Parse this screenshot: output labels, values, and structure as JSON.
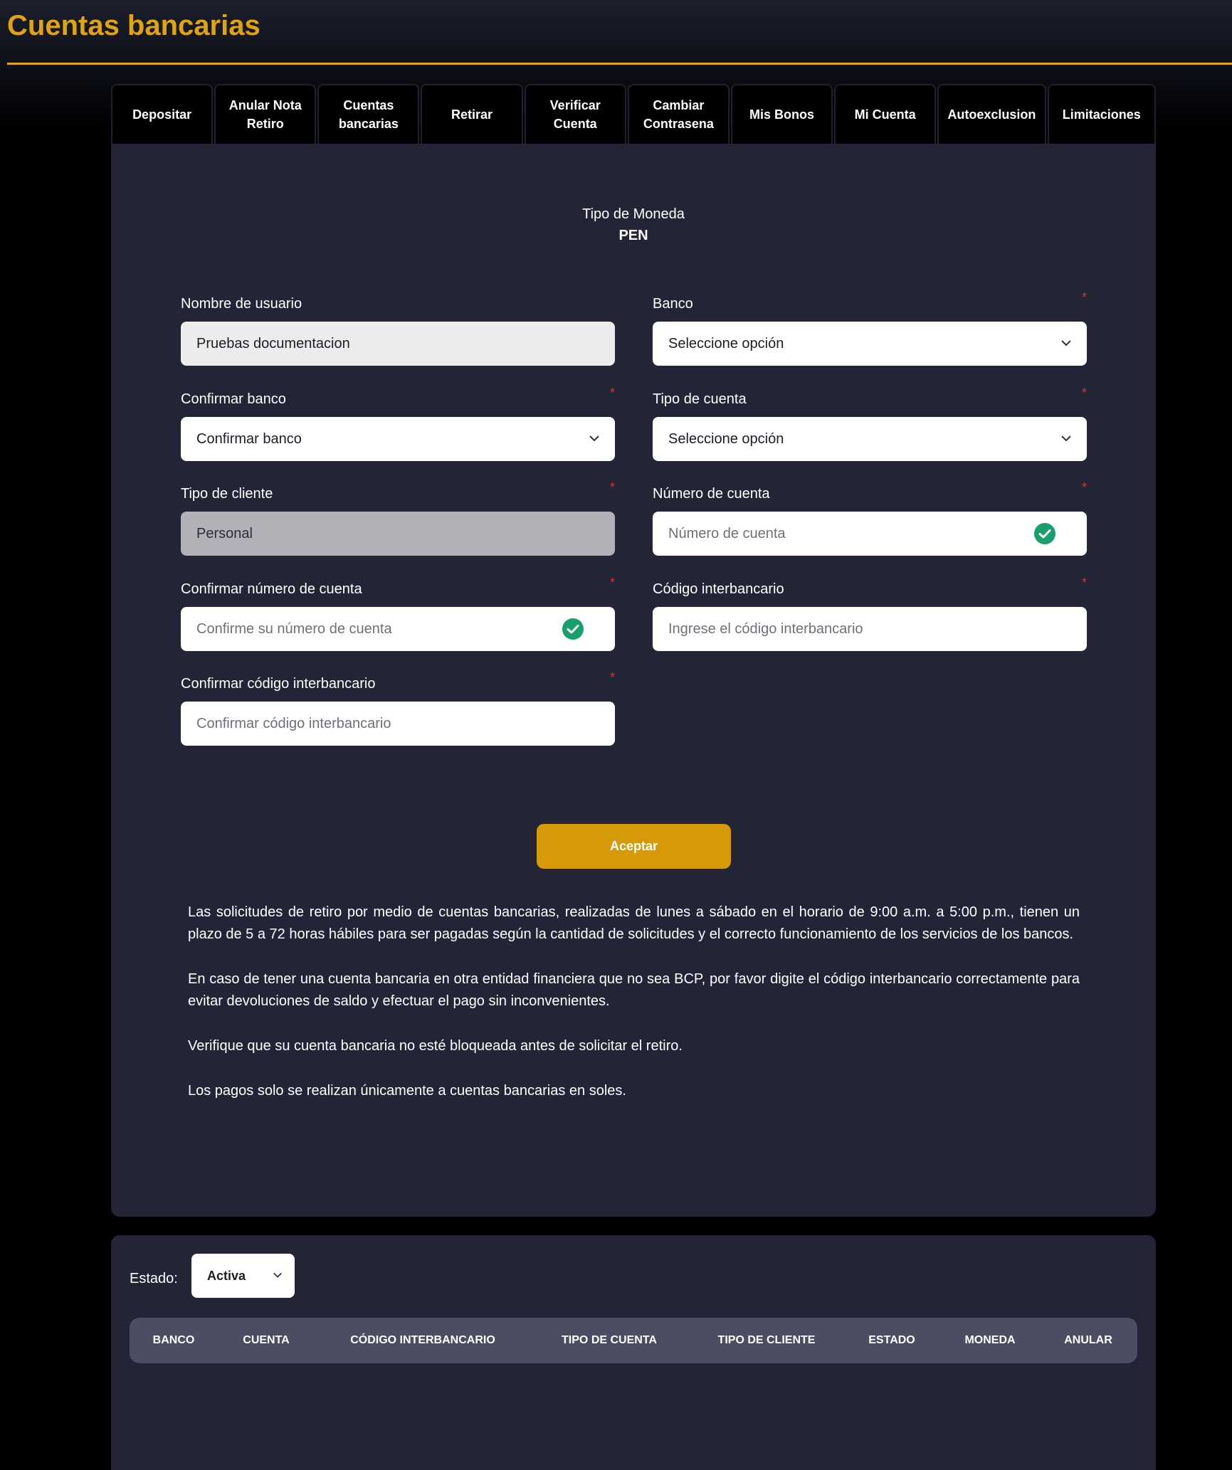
{
  "page": {
    "title": "Cuentas bancarias"
  },
  "tabs": [
    "Depositar",
    "Anular Nota\nRetiro",
    "Cuentas\nbancarias",
    "Retirar",
    "Verificar\nCuenta",
    "Cambiar\nContrasena",
    "Mis Bonos",
    "Mi Cuenta",
    "Autoexclusion",
    "Limitaciones"
  ],
  "currency": {
    "label": "Tipo de Moneda",
    "value": "PEN"
  },
  "form": {
    "required_mark": "*",
    "username": {
      "label": "Nombre de usuario",
      "value": "Pruebas  documentacion"
    },
    "bank": {
      "label": "Banco",
      "value": "Seleccione opción"
    },
    "confirm_bank": {
      "label": "Confirmar banco",
      "value": "Confirmar banco"
    },
    "account_type": {
      "label": "Tipo de cuenta",
      "value": "Seleccione opción"
    },
    "client_type": {
      "label": "Tipo de cliente",
      "value": "Personal"
    },
    "account_number": {
      "label": "Número de cuenta",
      "placeholder": "Número de cuenta"
    },
    "confirm_account_number": {
      "label": "Confirmar número de cuenta",
      "placeholder": "Confirme su número de cuenta"
    },
    "interbank_code": {
      "label": "Código interbancario",
      "placeholder": "Ingrese el código interbancario"
    },
    "confirm_interbank_code": {
      "label": "Confirmar código interbancario",
      "placeholder": "Confirmar código interbancario"
    },
    "submit_label": "Aceptar"
  },
  "info": [
    "Las solicitudes de retiro por medio de cuentas bancarias, realizadas de lunes a sábado en el horario de 9:00 a.m. a 5:00 p.m., tienen un plazo de 5 a 72 horas hábiles para ser pagadas según la cantidad de solicitudes y el correcto funcionamiento de los servicios de los bancos.",
    "En caso de tener una cuenta bancaria en otra entidad financiera que no sea BCP, por favor digite el código interbancario correctamente para evitar devoluciones de saldo y efectuar el pago sin inconvenientes.",
    "Verifique que su cuenta bancaria no esté bloqueada antes de solicitar el retiro.",
    "Los pagos solo se realizan únicamente a cuentas bancarias en soles."
  ],
  "filter": {
    "label": "Estado:",
    "value": "Activa"
  },
  "table": {
    "headers": [
      "BANCO",
      "CUENTA",
      "CÓDIGO INTERBANCARIO",
      "TIPO DE CUENTA",
      "TIPO DE CLIENTE",
      "ESTADO",
      "MONEDA",
      "ANULAR"
    ]
  },
  "icons": {
    "chevron": "chevron-down-icon",
    "valid": "check-circle-icon"
  },
  "colors": {
    "accent": "#e0a413",
    "button": "#d6990a",
    "panel": "#232536",
    "valid": "#17a06b",
    "required": "#d8322f"
  }
}
